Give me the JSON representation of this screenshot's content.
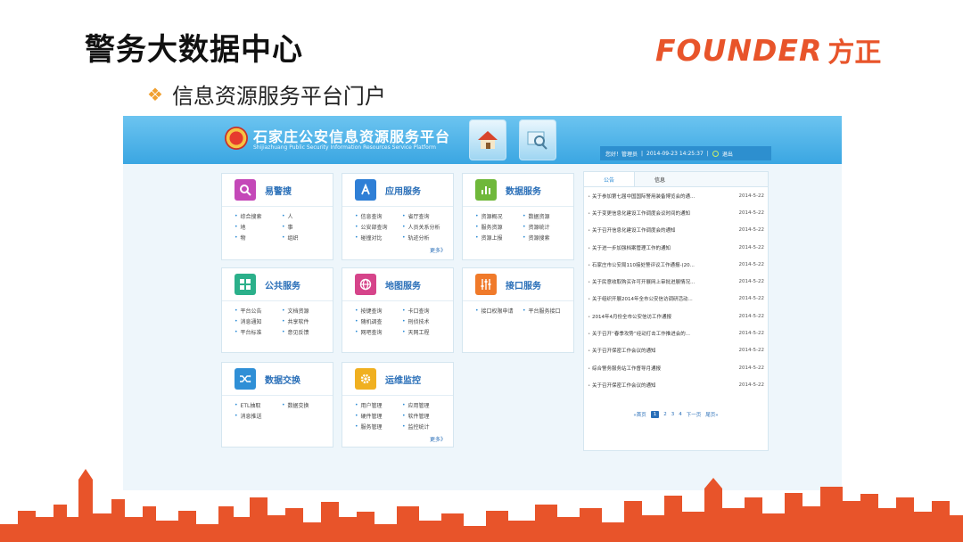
{
  "slide": {
    "title": "警务大数据中心",
    "bullet": "信息资源服务平台门户",
    "logo_en": "FOUNDER",
    "logo_cn": "方正"
  },
  "portal": {
    "title": "石家庄公安信息资源服务平台",
    "subtitle": "Shijiazhuang Public Security Information Resources Service Platform",
    "user_label": "您好！管理员",
    "datetime": "2014-09-23 14:25:37",
    "logout": "退出",
    "home_icon": "home-icon",
    "search_icon": "magnifier-icon"
  },
  "cards": {
    "yijingsou": {
      "title": "易警搜",
      "items": [
        "综合搜索",
        "人",
        "地",
        "事",
        "物",
        "组织"
      ]
    },
    "yingyong": {
      "title": "应用服务",
      "items": [
        "信息查询",
        "省厅查询",
        "公安部查询",
        "人员关系分析",
        "碰撞对比",
        "轨迹分析"
      ],
      "more": "更多》"
    },
    "shuju": {
      "title": "数据服务",
      "items": [
        "资源概况",
        "数据资源",
        "服务资源",
        "资源统计",
        "资源上报",
        "资源搜索"
      ]
    },
    "gonggong": {
      "title": "公共服务",
      "items": [
        "平台公告",
        "文档资源",
        "消息通知",
        "共享软件",
        "平台标准",
        "意见反馈"
      ]
    },
    "ditu": {
      "title": "地图服务",
      "items": [
        "按键查询",
        "卡口查询",
        "随机调查",
        "刑侦技术",
        "网吧查询",
        "天网工程"
      ]
    },
    "jiekou": {
      "title": "接口服务",
      "items": [
        "接口权限申请",
        "平台服务接口"
      ]
    },
    "jiaohuan": {
      "title": "数据交换",
      "items": [
        "ETL抽取",
        "数据交换",
        "消息推送"
      ]
    },
    "yunwei": {
      "title": "运维监控",
      "items": [
        "用户管理",
        "应用管理",
        "硬件管理",
        "软件管理",
        "服务管理",
        "监控统计"
      ],
      "more": "更多》"
    }
  },
  "notice": {
    "tabs": [
      "公告",
      "信息"
    ],
    "rows": [
      {
        "title": "关于参加第七届中国国际警用装备博览会的通...",
        "date": "2014-5-22"
      },
      {
        "title": "关于变更信息化建设工作调度会议时间的通知",
        "date": "2014-5-22"
      },
      {
        "title": "关于召开信息化建设工作调度会的通知",
        "date": "2014-5-22"
      },
      {
        "title": "关于进一步加强档案管理工作的通知",
        "date": "2014-5-22"
      },
      {
        "title": "石家庄市公安局110接处警评议工作通报-(20...",
        "date": "2014-5-22"
      },
      {
        "title": "关于民意收取购买许可开展网上审批进展情况...",
        "date": "2014-5-22"
      },
      {
        "title": "关于组织开展2014年全市公安信访调研活动...",
        "date": "2014-5-22"
      },
      {
        "title": "2014年4月份全市公安信访工作通报",
        "date": "2014-5-22"
      },
      {
        "title": "关于召开“春季攻势”经动打击工作推进会的...",
        "date": "2014-5-22"
      },
      {
        "title": "关于召开保密工作会议的通知",
        "date": "2014-5-22"
      },
      {
        "title": "综合警务服务站工作督导月通报",
        "date": "2014-5-22"
      },
      {
        "title": "关于召开保密工作会议的通知",
        "date": "2014-5-22"
      }
    ],
    "pager": {
      "first": "«首页",
      "pages": [
        "1",
        "2",
        "3",
        "4"
      ],
      "next": "下一页",
      "last": "尾页»"
    }
  },
  "colors": {
    "accent": "#e8542a",
    "banner": "#3aa6e2",
    "yijingsou": "#c448b8",
    "yingyong": "#2f7fd6",
    "shuju": "#6fb83a",
    "gonggong": "#2bb08a",
    "ditu": "#d6448a",
    "jiekou": "#f07a2a",
    "jiaohuan": "#2f8fd6",
    "yunwei": "#f0b020"
  }
}
